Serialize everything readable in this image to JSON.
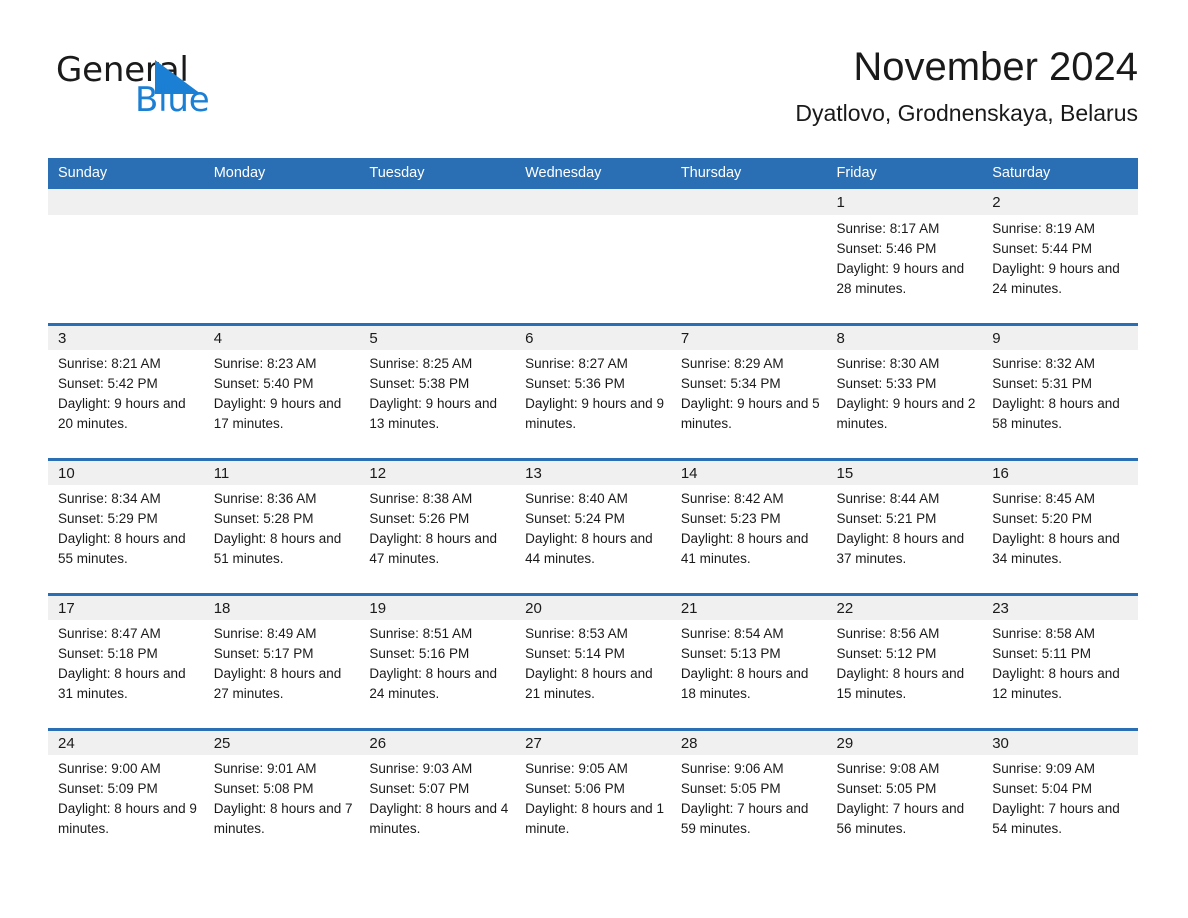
{
  "brand": {
    "name_part1": "General",
    "name_part2": "Blue",
    "flag_icon": "triangle-flag-icon",
    "flag_color": "#1b7fd4"
  },
  "header": {
    "month_title": "November 2024",
    "location": "Dyatlovo, Grodnenskaya, Belarus"
  },
  "colors": {
    "header_blue": "#2a6eb3",
    "row_separator_blue": "#2a6eb3",
    "daynum_strip": "#f0f0f0",
    "text": "#1a1a1a",
    "brand_blue": "#1b7fd4"
  },
  "calendar": {
    "weekdays": [
      "Sunday",
      "Monday",
      "Tuesday",
      "Wednesday",
      "Thursday",
      "Friday",
      "Saturday"
    ],
    "weeks": [
      [
        {
          "day": "",
          "sunrise": "",
          "sunset": "",
          "daylight": ""
        },
        {
          "day": "",
          "sunrise": "",
          "sunset": "",
          "daylight": ""
        },
        {
          "day": "",
          "sunrise": "",
          "sunset": "",
          "daylight": ""
        },
        {
          "day": "",
          "sunrise": "",
          "sunset": "",
          "daylight": ""
        },
        {
          "day": "",
          "sunrise": "",
          "sunset": "",
          "daylight": ""
        },
        {
          "day": "1",
          "sunrise": "Sunrise: 8:17 AM",
          "sunset": "Sunset: 5:46 PM",
          "daylight": "Daylight: 9 hours and 28 minutes."
        },
        {
          "day": "2",
          "sunrise": "Sunrise: 8:19 AM",
          "sunset": "Sunset: 5:44 PM",
          "daylight": "Daylight: 9 hours and 24 minutes."
        }
      ],
      [
        {
          "day": "3",
          "sunrise": "Sunrise: 8:21 AM",
          "sunset": "Sunset: 5:42 PM",
          "daylight": "Daylight: 9 hours and 20 minutes."
        },
        {
          "day": "4",
          "sunrise": "Sunrise: 8:23 AM",
          "sunset": "Sunset: 5:40 PM",
          "daylight": "Daylight: 9 hours and 17 minutes."
        },
        {
          "day": "5",
          "sunrise": "Sunrise: 8:25 AM",
          "sunset": "Sunset: 5:38 PM",
          "daylight": "Daylight: 9 hours and 13 minutes."
        },
        {
          "day": "6",
          "sunrise": "Sunrise: 8:27 AM",
          "sunset": "Sunset: 5:36 PM",
          "daylight": "Daylight: 9 hours and 9 minutes."
        },
        {
          "day": "7",
          "sunrise": "Sunrise: 8:29 AM",
          "sunset": "Sunset: 5:34 PM",
          "daylight": "Daylight: 9 hours and 5 minutes."
        },
        {
          "day": "8",
          "sunrise": "Sunrise: 8:30 AM",
          "sunset": "Sunset: 5:33 PM",
          "daylight": "Daylight: 9 hours and 2 minutes."
        },
        {
          "day": "9",
          "sunrise": "Sunrise: 8:32 AM",
          "sunset": "Sunset: 5:31 PM",
          "daylight": "Daylight: 8 hours and 58 minutes."
        }
      ],
      [
        {
          "day": "10",
          "sunrise": "Sunrise: 8:34 AM",
          "sunset": "Sunset: 5:29 PM",
          "daylight": "Daylight: 8 hours and 55 minutes."
        },
        {
          "day": "11",
          "sunrise": "Sunrise: 8:36 AM",
          "sunset": "Sunset: 5:28 PM",
          "daylight": "Daylight: 8 hours and 51 minutes."
        },
        {
          "day": "12",
          "sunrise": "Sunrise: 8:38 AM",
          "sunset": "Sunset: 5:26 PM",
          "daylight": "Daylight: 8 hours and 47 minutes."
        },
        {
          "day": "13",
          "sunrise": "Sunrise: 8:40 AM",
          "sunset": "Sunset: 5:24 PM",
          "daylight": "Daylight: 8 hours and 44 minutes."
        },
        {
          "day": "14",
          "sunrise": "Sunrise: 8:42 AM",
          "sunset": "Sunset: 5:23 PM",
          "daylight": "Daylight: 8 hours and 41 minutes."
        },
        {
          "day": "15",
          "sunrise": "Sunrise: 8:44 AM",
          "sunset": "Sunset: 5:21 PM",
          "daylight": "Daylight: 8 hours and 37 minutes."
        },
        {
          "day": "16",
          "sunrise": "Sunrise: 8:45 AM",
          "sunset": "Sunset: 5:20 PM",
          "daylight": "Daylight: 8 hours and 34 minutes."
        }
      ],
      [
        {
          "day": "17",
          "sunrise": "Sunrise: 8:47 AM",
          "sunset": "Sunset: 5:18 PM",
          "daylight": "Daylight: 8 hours and 31 minutes."
        },
        {
          "day": "18",
          "sunrise": "Sunrise: 8:49 AM",
          "sunset": "Sunset: 5:17 PM",
          "daylight": "Daylight: 8 hours and 27 minutes."
        },
        {
          "day": "19",
          "sunrise": "Sunrise: 8:51 AM",
          "sunset": "Sunset: 5:16 PM",
          "daylight": "Daylight: 8 hours and 24 minutes."
        },
        {
          "day": "20",
          "sunrise": "Sunrise: 8:53 AM",
          "sunset": "Sunset: 5:14 PM",
          "daylight": "Daylight: 8 hours and 21 minutes."
        },
        {
          "day": "21",
          "sunrise": "Sunrise: 8:54 AM",
          "sunset": "Sunset: 5:13 PM",
          "daylight": "Daylight: 8 hours and 18 minutes."
        },
        {
          "day": "22",
          "sunrise": "Sunrise: 8:56 AM",
          "sunset": "Sunset: 5:12 PM",
          "daylight": "Daylight: 8 hours and 15 minutes."
        },
        {
          "day": "23",
          "sunrise": "Sunrise: 8:58 AM",
          "sunset": "Sunset: 5:11 PM",
          "daylight": "Daylight: 8 hours and 12 minutes."
        }
      ],
      [
        {
          "day": "24",
          "sunrise": "Sunrise: 9:00 AM",
          "sunset": "Sunset: 5:09 PM",
          "daylight": "Daylight: 8 hours and 9 minutes."
        },
        {
          "day": "25",
          "sunrise": "Sunrise: 9:01 AM",
          "sunset": "Sunset: 5:08 PM",
          "daylight": "Daylight: 8 hours and 7 minutes."
        },
        {
          "day": "26",
          "sunrise": "Sunrise: 9:03 AM",
          "sunset": "Sunset: 5:07 PM",
          "daylight": "Daylight: 8 hours and 4 minutes."
        },
        {
          "day": "27",
          "sunrise": "Sunrise: 9:05 AM",
          "sunset": "Sunset: 5:06 PM",
          "daylight": "Daylight: 8 hours and 1 minute."
        },
        {
          "day": "28",
          "sunrise": "Sunrise: 9:06 AM",
          "sunset": "Sunset: 5:05 PM",
          "daylight": "Daylight: 7 hours and 59 minutes."
        },
        {
          "day": "29",
          "sunrise": "Sunrise: 9:08 AM",
          "sunset": "Sunset: 5:05 PM",
          "daylight": "Daylight: 7 hours and 56 minutes."
        },
        {
          "day": "30",
          "sunrise": "Sunrise: 9:09 AM",
          "sunset": "Sunset: 5:04 PM",
          "daylight": "Daylight: 7 hours and 54 minutes."
        }
      ]
    ]
  }
}
